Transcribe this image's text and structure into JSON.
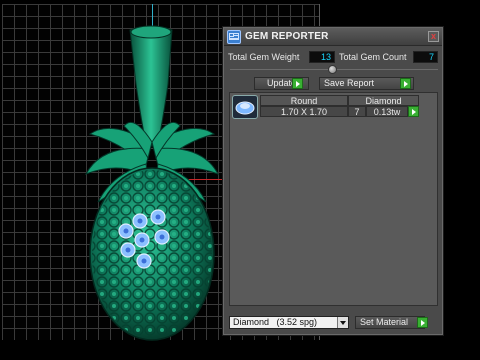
{
  "panel": {
    "title": "GEM REPORTER",
    "close_glyph": "x",
    "total_weight_label": "Total Gem Weight",
    "total_weight_value": "13",
    "total_count_label": "Total Gem Count",
    "total_count_value": "7",
    "update_label": "Update",
    "save_report_label": "Save Report"
  },
  "gems": [
    {
      "shape": "Round",
      "material": "Diamond",
      "size": "1.70 X 1.70",
      "count": "7",
      "weight": "0.13tw"
    }
  ],
  "bottom": {
    "material_selected": "Diamond   (3.52 spg)",
    "set_material_label": "Set Material"
  },
  "icons": {
    "app_icon": "gem-reporter-icon",
    "close": "close-icon",
    "go": "green-arrow-icon",
    "dropdown": "chevron-down-icon",
    "gem_thumb": "diamond-thumbnail-icon"
  },
  "colors": {
    "value_text": "#19d6ff",
    "go_button": "#39b033",
    "model": "#0f8a66",
    "gem": "#7db8ff",
    "axis_x": "#c8282a",
    "axis_y": "#2fb0c9"
  }
}
